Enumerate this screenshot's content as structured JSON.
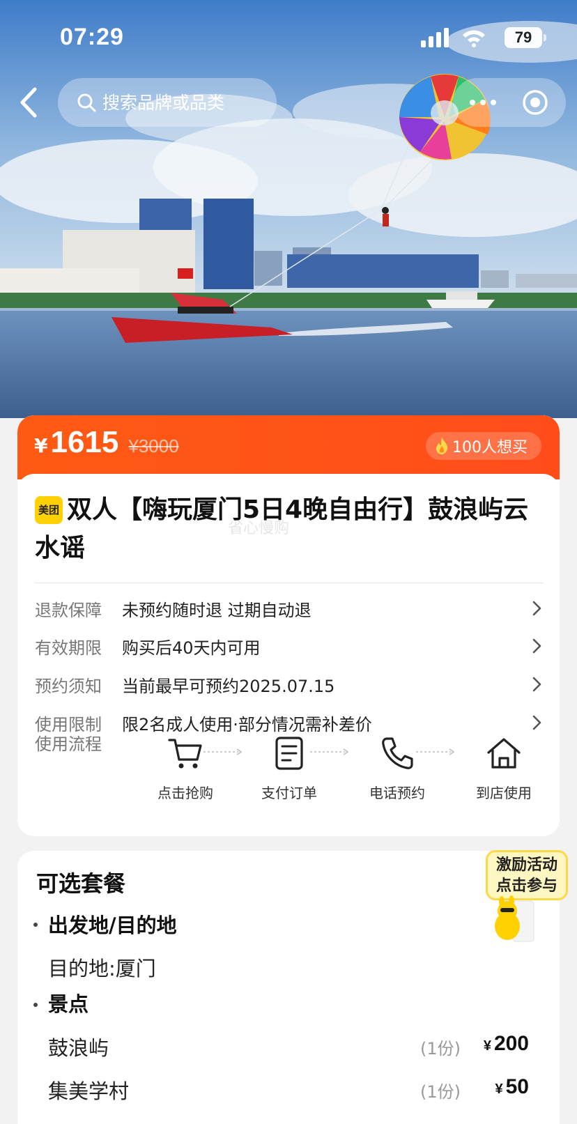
{
  "status_bar": {
    "time": "07:29",
    "battery": "79"
  },
  "header": {
    "search_placeholder": "搜索品牌或品类"
  },
  "price": {
    "currency": "¥",
    "current": "1615",
    "original": "¥3000",
    "want_count": "100人想买"
  },
  "product": {
    "brand_logo": "美团",
    "title": "双人【嗨玩厦门5日4晚自由行】鼓浪屿云水谣",
    "watermark": "省心慢购"
  },
  "info_rows": [
    {
      "label": "退款保障",
      "value": "未预约随时退 过期自动退"
    },
    {
      "label": "有效期限",
      "value": "购买后40天内可用"
    },
    {
      "label": "预约须知",
      "value": "当前最早可预约2025.07.15"
    },
    {
      "label": "使用限制",
      "value": "限2名成人使用·部分情况需补差价"
    }
  ],
  "usage_flow": {
    "label": "使用流程",
    "steps": [
      {
        "icon": "cart-icon",
        "label": "点击抢购"
      },
      {
        "icon": "order-icon",
        "label": "支付订单"
      },
      {
        "icon": "phone-icon",
        "label": "电话预约"
      },
      {
        "icon": "home-icon",
        "label": "到店使用"
      }
    ]
  },
  "packages": {
    "title": "可选套餐",
    "groups": [
      {
        "title": "出发地/目的地",
        "items": [
          {
            "name": "目的地:厦门"
          }
        ]
      },
      {
        "title": "景点",
        "items": [
          {
            "name": "鼓浪屿",
            "qty": "(1份)",
            "currency": "¥",
            "price": "200"
          },
          {
            "name": "集美学村",
            "qty": "(1份)",
            "currency": "¥",
            "price": "50"
          }
        ]
      }
    ]
  },
  "promo": {
    "line1": "激励活动",
    "line2": "点击参与"
  },
  "colors": {
    "accent": "#ff5214",
    "brand_yellow": "#ffd100"
  }
}
